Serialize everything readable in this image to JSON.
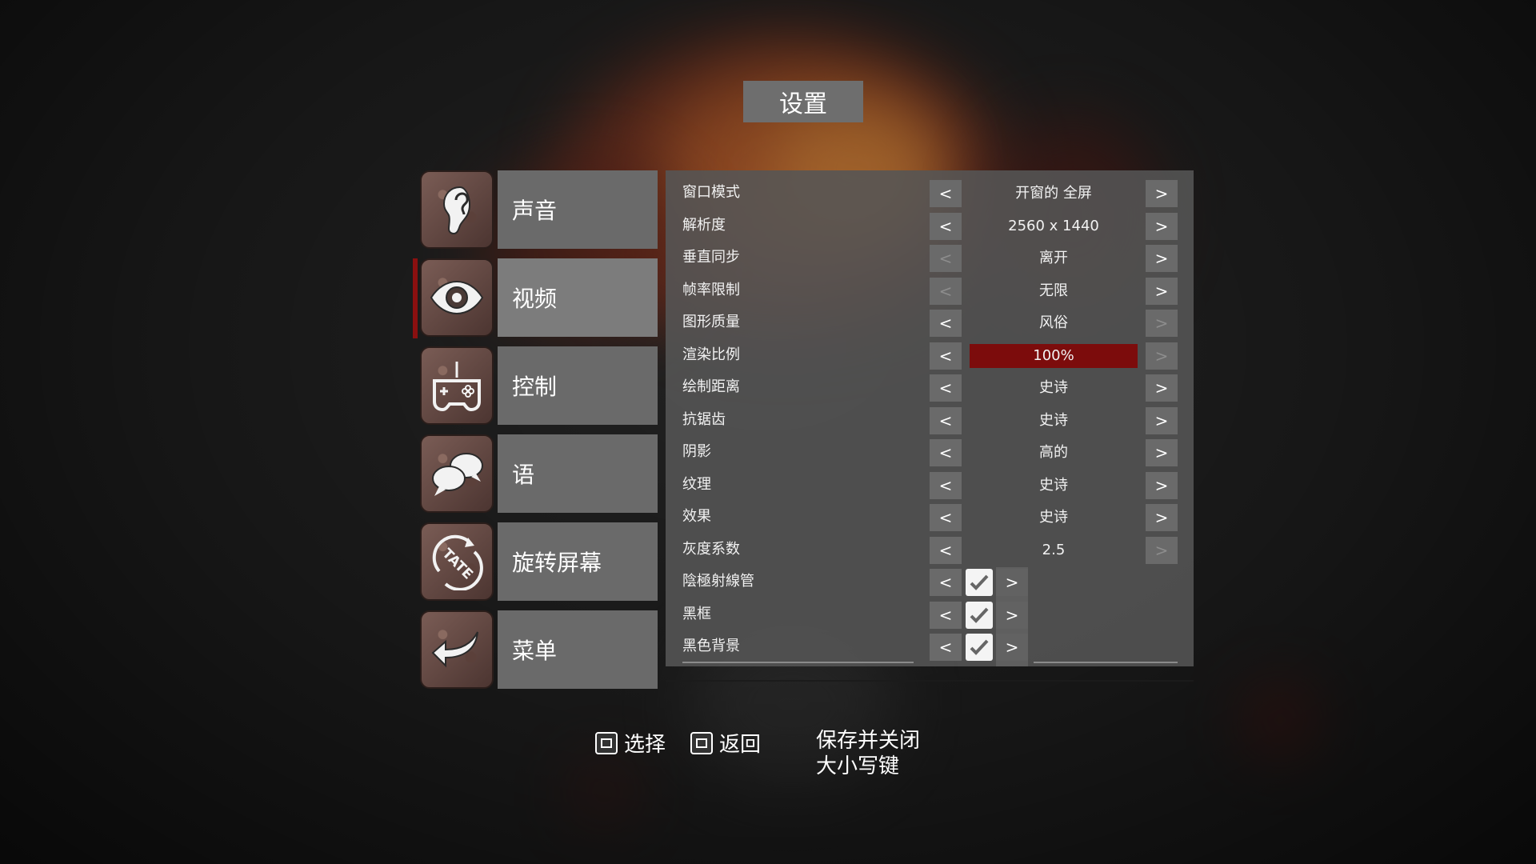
{
  "title": "设置",
  "categories": [
    {
      "label": "声音",
      "icon": "ear-icon"
    },
    {
      "label": "视频",
      "icon": "eye-icon",
      "active": true
    },
    {
      "label": "控制",
      "icon": "gamepad-icon"
    },
    {
      "label": "语",
      "icon": "speech-bubbles-icon"
    },
    {
      "label": "旋转屏幕",
      "icon": "tate-rotate-icon"
    },
    {
      "label": "菜单",
      "icon": "back-arrow-icon"
    }
  ],
  "settings": [
    {
      "name": "窗口模式",
      "value": "开窗的 全屏"
    },
    {
      "name": "解析度",
      "value": "2560 x 1440"
    },
    {
      "name": "垂直同步",
      "value": "离开"
    },
    {
      "name": "帧率限制",
      "value": "无限"
    },
    {
      "name": "图形质量",
      "value": "风俗"
    },
    {
      "name": "渲染比例",
      "value": "100%"
    },
    {
      "name": "绘制距离",
      "value": "史诗"
    },
    {
      "name": "抗锯齿",
      "value": "史诗"
    },
    {
      "name": "阴影",
      "value": "高的"
    },
    {
      "name": "纹理",
      "value": "史诗"
    },
    {
      "name": "效果",
      "value": "史诗"
    },
    {
      "name": "灰度系数",
      "value": "2.5"
    },
    {
      "name": "陰極射線管",
      "checked": true
    },
    {
      "name": "黑框",
      "checked": true
    },
    {
      "name": "黑色背景",
      "checked": true
    }
  ],
  "arrows": {
    "left": "<",
    "right": ">"
  },
  "render_scale_fraction": 1.0,
  "footer": {
    "select_label": "选择",
    "back_label": "返回",
    "save_close_label": "保存并关闭",
    "caps_label": "大小写键"
  },
  "colors": {
    "accent": "#7c0c0c",
    "active_marker": "#8a1010"
  }
}
